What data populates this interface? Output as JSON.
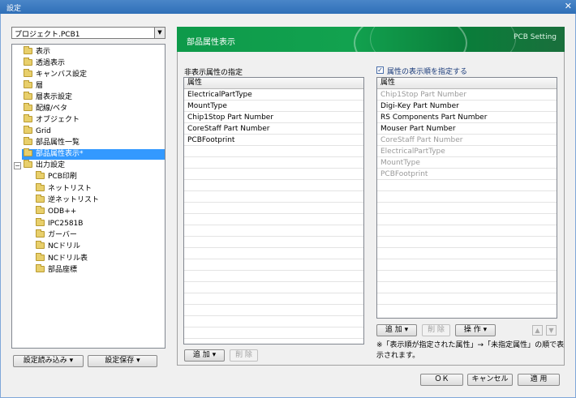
{
  "window": {
    "title": "設定",
    "close_glyph": "✕"
  },
  "project": {
    "selected": "プロジェクト.PCB1"
  },
  "tree": {
    "items": [
      {
        "label": "表示"
      },
      {
        "label": "透過表示"
      },
      {
        "label": "キャンバス設定"
      },
      {
        "label": "層"
      },
      {
        "label": "層表示設定"
      },
      {
        "label": "配線/ベタ"
      },
      {
        "label": "オブジェクト"
      },
      {
        "label": "Grid"
      },
      {
        "label": "部品属性一覧"
      },
      {
        "label": "部品属性表示*"
      },
      {
        "label": "出力設定"
      }
    ],
    "output_children": [
      {
        "label": "PCB印刷"
      },
      {
        "label": "ネットリスト"
      },
      {
        "label": "逆ネットリスト"
      },
      {
        "label": "ODB++"
      },
      {
        "label": "IPC2581B"
      },
      {
        "label": "ガーバー"
      },
      {
        "label": "NCドリル"
      },
      {
        "label": "NCドリル表"
      },
      {
        "label": "部品座標"
      }
    ],
    "expander_glyph": "−"
  },
  "bottom_left": {
    "load_label": "設定読み込み ▾",
    "save_label": "設定保存 ▾"
  },
  "banner": {
    "title": "部品属性表示",
    "right_text": "PCB Setting"
  },
  "left_group": {
    "title": "非表示属性の指定",
    "header": "属性",
    "rows": [
      "ElectricalPartType",
      "MountType",
      "Chip1Stop Part Number",
      "CoreStaff Part Number",
      "PCBFootprint"
    ],
    "add_label": "追 加 ▾",
    "delete_label": "削 除"
  },
  "right_group": {
    "checkbox_label": "属性の表示順を指定する",
    "checked_glyph": "✓",
    "header": "属性",
    "rows": [
      {
        "label": "Chip1Stop Part Number",
        "dim": true
      },
      {
        "label": "Digi-Key Part Number",
        "dim": false
      },
      {
        "label": "RS Components Part Number",
        "dim": false
      },
      {
        "label": "Mouser Part Number",
        "dim": false
      },
      {
        "label": "CoreStaff Part Number",
        "dim": true
      },
      {
        "label": "ElectricalPartType",
        "dim": true
      },
      {
        "label": "MountType",
        "dim": true
      },
      {
        "label": "PCBFootprint",
        "dim": true
      }
    ],
    "add_label": "追 加 ▾",
    "delete_label": "削 除",
    "operation_label": "操 作 ▾",
    "up_glyph": "▲",
    "down_glyph": "▼",
    "note": "※「表示順が指定された属性」→「未指定属性」の順で表示されます。"
  },
  "dialog_buttons": {
    "ok": "ＯＫ",
    "cancel": "キャンセル",
    "apply": "適 用"
  },
  "colors": {
    "titlebar": "#2f6fb8",
    "banner": "#12a24f",
    "selection": "#3399ff"
  }
}
